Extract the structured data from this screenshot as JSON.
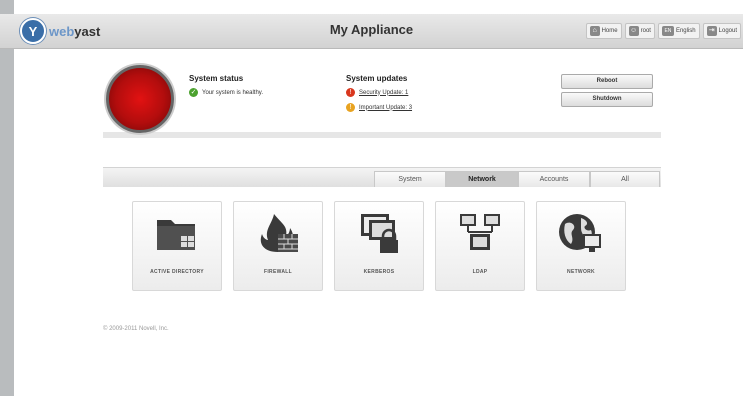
{
  "header": {
    "logo_web": "web",
    "logo_yast": "yast",
    "app_title": "My Appliance",
    "nav": [
      {
        "label": "Home",
        "icon": "home-icon"
      },
      {
        "label": "root",
        "icon": "user-icon"
      },
      {
        "label": "English",
        "icon": "language-icon",
        "badge": "EN"
      },
      {
        "label": "Logout",
        "icon": "logout-icon"
      }
    ]
  },
  "status": {
    "system_status_title": "System status",
    "healthy_text": "Your system is healthy.",
    "updates_title": "System updates",
    "security_updates": "Security Update: 1",
    "important_updates": "Important Update: 3",
    "reboot_label": "Reboot",
    "shutdown_label": "Shutdown",
    "light_color": "#d11212"
  },
  "tabs": [
    {
      "label": "System"
    },
    {
      "label": "Network",
      "active": true
    },
    {
      "label": "Accounts"
    },
    {
      "label": "All"
    }
  ],
  "modules": [
    {
      "label": "ACTIVE DIRECTORY",
      "icon": "folder-windows-icon"
    },
    {
      "label": "FIREWALL",
      "icon": "firewall-icon"
    },
    {
      "label": "KERBEROS",
      "icon": "kerberos-lock-icon"
    },
    {
      "label": "LDAP",
      "icon": "ldap-network-icon"
    },
    {
      "label": "NETWORK",
      "icon": "globe-network-icon"
    }
  ],
  "footer": {
    "copyright": "© 2009-2011 Novell, Inc."
  }
}
